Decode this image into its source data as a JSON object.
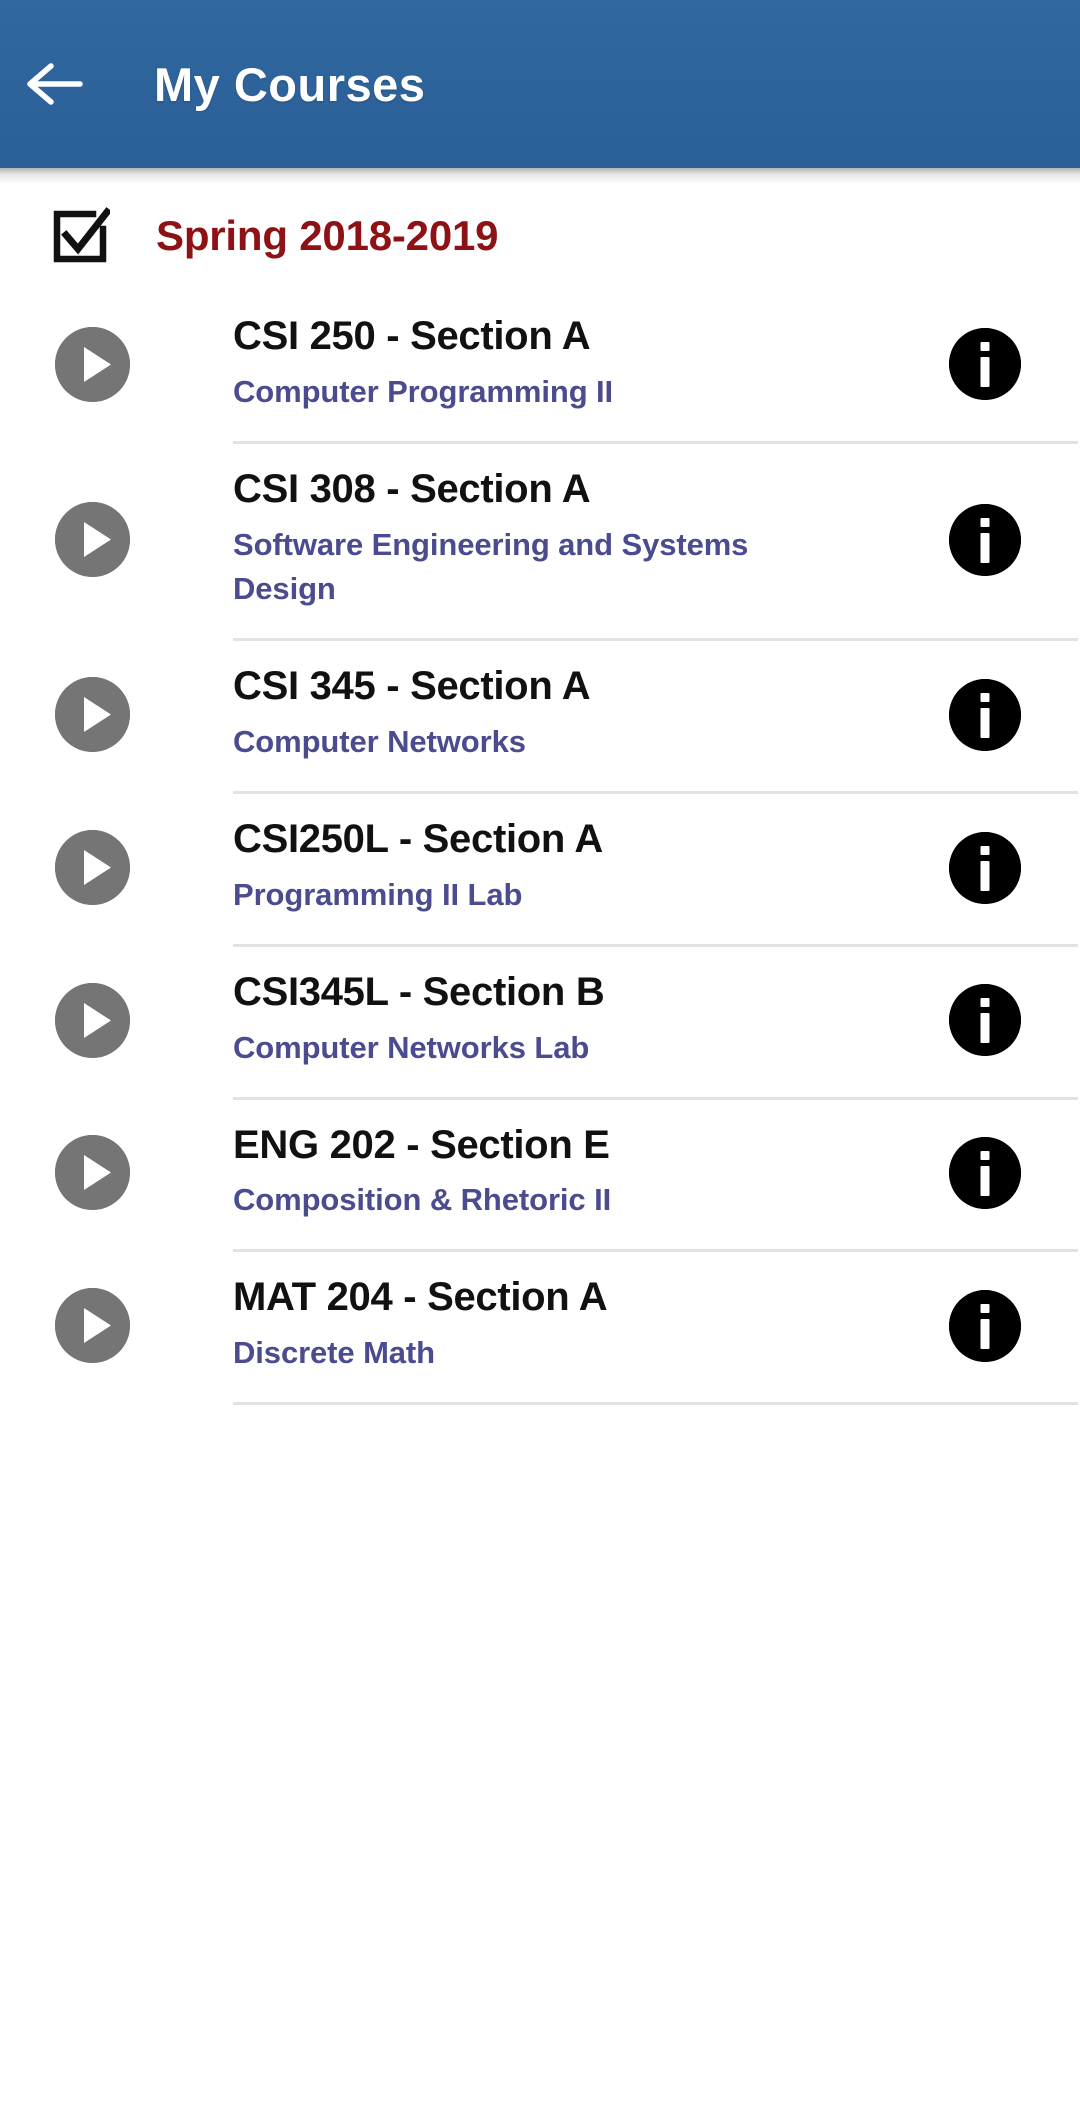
{
  "appbar": {
    "title": "My Courses",
    "back_icon": "arrow-left-icon",
    "background_color": "#2d659f",
    "title_color": "#ffffff"
  },
  "semester": {
    "label": "Spring 2018-2019",
    "checkbox_icon": "checkbox-checked-icon",
    "checked": true,
    "label_color": "#8d1115"
  },
  "icons": {
    "play": "play-circle-icon",
    "info": "info-circle-icon",
    "play_color": "#757575",
    "info_color": "#000000"
  },
  "courses": [
    {
      "code": "CSI 250 - Section A",
      "name": "Computer Programming II"
    },
    {
      "code": "CSI 308 - Section A",
      "name": "Software Engineering and Systems Design"
    },
    {
      "code": "CSI 345 - Section A",
      "name": "Computer Networks"
    },
    {
      "code": "CSI250L - Section A",
      "name": "Programming II Lab"
    },
    {
      "code": "CSI345L - Section B",
      "name": "Computer Networks Lab"
    },
    {
      "code": "ENG 202 - Section E",
      "name": "Composition & Rhetoric II"
    },
    {
      "code": "MAT 204 - Section A",
      "name": "Discrete Math"
    }
  ]
}
